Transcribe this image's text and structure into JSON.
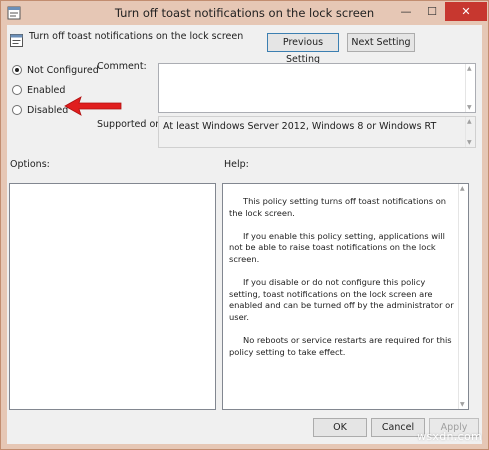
{
  "window": {
    "title": "Turn off toast notifications on the lock screen",
    "min_glyph": "—",
    "max_glyph": "☐",
    "close_glyph": "✕"
  },
  "header": {
    "policy_name": "Turn off toast notifications on the lock screen",
    "prev_label": "Previous Setting",
    "next_label": "Next Setting"
  },
  "state": {
    "options": [
      {
        "label": "Not Configured",
        "checked": true
      },
      {
        "label": "Enabled",
        "checked": false
      },
      {
        "label": "Disabled",
        "checked": false
      }
    ]
  },
  "comment": {
    "label": "Comment:",
    "value": ""
  },
  "supported": {
    "label": "Supported on:",
    "value": "At least Windows Server 2012, Windows 8 or Windows RT"
  },
  "panes": {
    "options_label": "Options:",
    "help_label": "Help:",
    "help_paragraphs": [
      "This policy setting turns off toast notifications on the lock screen.",
      "If you enable this policy setting, applications will not be able to raise toast notifications on the lock screen.",
      "If you disable or do not configure this policy setting, toast notifications on the lock screen are enabled and can be turned off by the administrator or user.",
      "No reboots or service restarts are required for this policy setting to take effect."
    ]
  },
  "footer": {
    "ok_label": "OK",
    "cancel_label": "Cancel",
    "apply_label": "Apply"
  },
  "watermark": "wsxdn.com",
  "colors": {
    "title_bar": "#e6c7b5",
    "close_button": "#c7372f",
    "annotation_arrow": "#e01e1e"
  },
  "icons": {
    "title": "policy-settings-icon",
    "header": "policy-settings-icon",
    "annotation": "red-arrow-icon"
  }
}
